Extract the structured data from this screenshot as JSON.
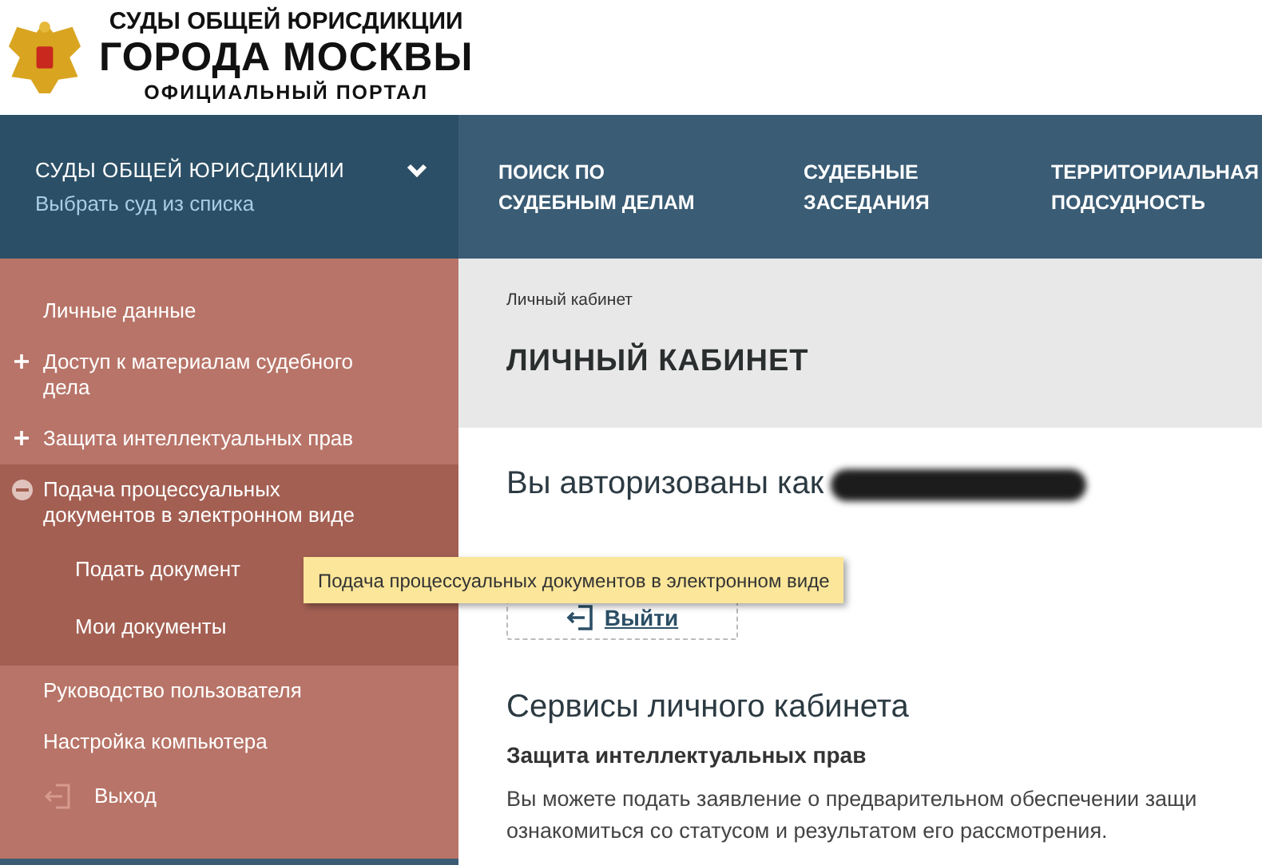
{
  "header": {
    "title_lines": [
      "СУДЫ ОБЩЕЙ ЮРИСДИКЦИИ",
      "ГОРОДА МОСКВЫ",
      "ОФИЦИАЛЬНЫЙ ПОРТАЛ"
    ]
  },
  "court_selector": {
    "title": "СУДЫ ОБЩЕЙ ЮРИСДИКЦИИ",
    "link": "Выбрать суд из списка"
  },
  "nav": [
    {
      "label": "ПОИСК ПО\nСУДЕБНЫМ ДЕЛАМ"
    },
    {
      "label": "СУДЕБНЫЕ\nЗАСЕДАНИЯ"
    },
    {
      "label": "ТЕРРИТОРИАЛЬНАЯ\nПОДСУДНОСТЬ"
    }
  ],
  "sidebar": {
    "items": [
      {
        "kind": "plain",
        "label": "Личные данные"
      },
      {
        "kind": "toggle",
        "label": "Доступ к материалам судебного\nдела",
        "expanded": false
      },
      {
        "kind": "toggle",
        "label": "Защита интеллектуальных прав",
        "expanded": false
      },
      {
        "kind": "toggle",
        "label": "Подача процессуальных\nдокументов в электронном виде",
        "expanded": true,
        "children": [
          {
            "label": "Подать документ"
          },
          {
            "label": "Мои документы"
          }
        ]
      },
      {
        "kind": "plain",
        "label": "Руководство пользователя"
      },
      {
        "kind": "plain",
        "label": "Настройка компьютера"
      },
      {
        "kind": "exit",
        "label": "Выход"
      }
    ]
  },
  "tooltip": "Подача процессуальных документов в электронном виде",
  "breadcrumb": "Личный кабинет",
  "page_title": "ЛИЧНЫЙ КАБИНЕТ",
  "authorized_as": "Вы авторизованы как",
  "logout_button": "Выйти",
  "services_title": "Сервисы личного кабинета",
  "section_title": "Защита интеллектуальных прав",
  "section_text": "Вы можете подать заявление о предварительном обеспечении защи\nознакомиться со статусом и результатом его рассмотрения."
}
